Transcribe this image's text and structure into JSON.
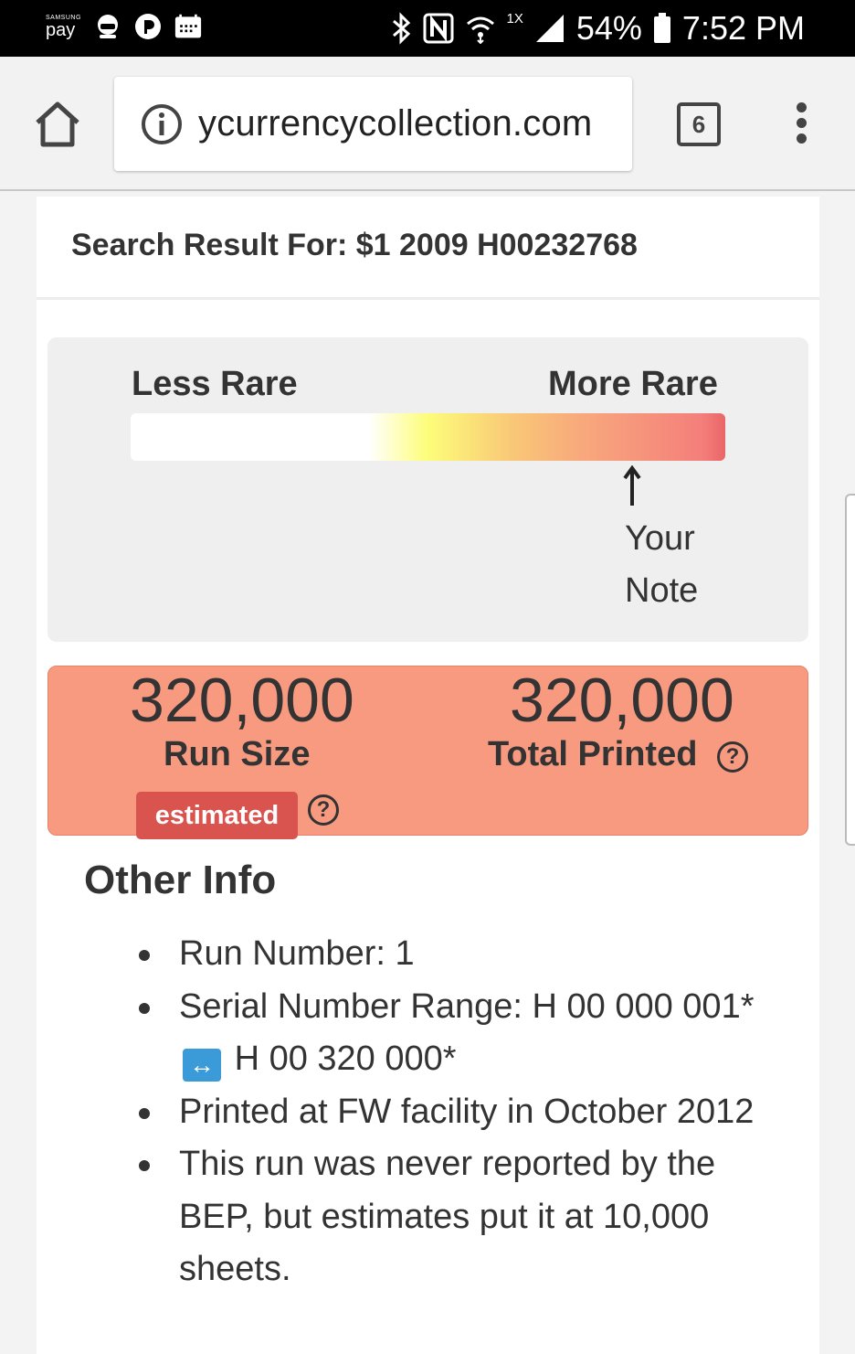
{
  "status_bar": {
    "pay_brand": "SAMSUNG",
    "pay_label": "pay",
    "extra_label": "1X",
    "battery": "54%",
    "time": "7:52 PM"
  },
  "browser": {
    "url": "ycurrencycollection.com",
    "tab_count": "6"
  },
  "search": {
    "result_text": "Search Result For: $1 2009 H00232768"
  },
  "rarity": {
    "less_label": "Less Rare",
    "more_label": "More Rare",
    "your_note_line1": "Your",
    "your_note_line2": "Note"
  },
  "stats": {
    "run_size_value": "320,000",
    "run_size_label": "Run Size",
    "estimated_badge": "estimated",
    "total_printed_value": "320,000",
    "total_printed_label": "Total Printed",
    "help_glyph": "?"
  },
  "other_info": {
    "title": "Other Info",
    "run_number": "Run Number: 1",
    "serial_range_start": "Serial Number Range: H 00 000 001*",
    "serial_range_arrow": "↔",
    "serial_range_end": "H 00 320 000*",
    "printed_at": "Printed at FW facility in October 2012",
    "note": "This run was never reported by the BEP, but estimates put it at 10,000 sheets."
  }
}
